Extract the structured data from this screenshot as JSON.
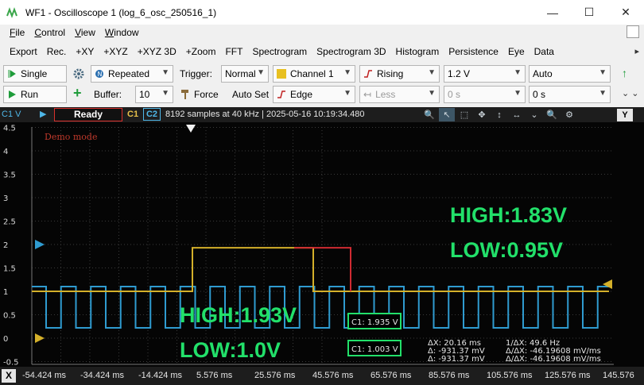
{
  "window": {
    "title": "WF1 - Oscilloscope 1 (log_6_osc_250516_1)",
    "minimize": "—",
    "maximize": "☐",
    "close": "✕"
  },
  "menu": [
    {
      "label": "File"
    },
    {
      "label": "Control"
    },
    {
      "label": "View"
    },
    {
      "label": "Window"
    }
  ],
  "toolbar": [
    "Export",
    "Rec.",
    "+XY",
    "+XYZ",
    "+XYZ 3D",
    "+Zoom",
    "FFT",
    "Spectrogram",
    "Spectrogram 3D",
    "Histogram",
    "Persistence",
    "Eye",
    "Data"
  ],
  "toolbar_more": "▸",
  "controls": {
    "single": "Single",
    "repeated": "Repeated",
    "trigger_label": "Trigger:",
    "trigger_mode": "Normal",
    "channel": "Channel 1",
    "edge_dir": "Rising",
    "level": "1.2 V",
    "auto": "Auto",
    "run": "Run",
    "buffer_label": "Buffer:",
    "buffer_value": "10",
    "force": "Force",
    "autoset": "Auto Set",
    "edge": "Edge",
    "less": "Less",
    "hold1": "0 s",
    "hold2": "0 s"
  },
  "scope": {
    "channel_label": "C1 V",
    "status": "Ready",
    "c1": "C1",
    "c2": "C2",
    "samples": "8192 samples at 40 kHz  |  2025-05-16 10:19:34.480",
    "demo": "Demo mode",
    "y_button": "Y",
    "x_button": "X",
    "y_ticks": [
      "4.5",
      "4",
      "3.5",
      "3",
      "2.5",
      "2",
      "1.5",
      "1",
      "0.5",
      "0",
      "-0.5"
    ],
    "x_ticks": [
      "-54.424 ms",
      "-34.424 ms",
      "-14.424 ms",
      "5.576 ms",
      "25.576 ms",
      "45.576 ms",
      "65.576 ms",
      "85.576 ms",
      "105.576 ms",
      "125.576 ms",
      "145.576"
    ]
  },
  "annotations": {
    "c2_high": "HIGH:1.83V",
    "c2_low": "LOW:0.95V",
    "c1_high": "HIGH:1.93V",
    "c1_low": "LOW:1.0V"
  },
  "measurements": {
    "y1_c1": "C1: 1.935 V",
    "y2_c1": "C1: 1.003 V",
    "dx": "ΔX: 20.16 ms",
    "inv_dx": "1/ΔX: 49.6 Hz",
    "dy1": "Δ: -931.37 mV",
    "ratio1": "Δ/ΔX: -46.19608 mV/ms",
    "dy2": "Δ: -931.37 mV",
    "ratio2": "Δ/ΔX: -46.19608 mV/ms"
  },
  "colors": {
    "c1": "#d4b02a",
    "c2": "#2f9bd0",
    "cursor_red": "#d02b32",
    "annotation_green": "#22e06a",
    "grid": "#3a3a3a"
  }
}
